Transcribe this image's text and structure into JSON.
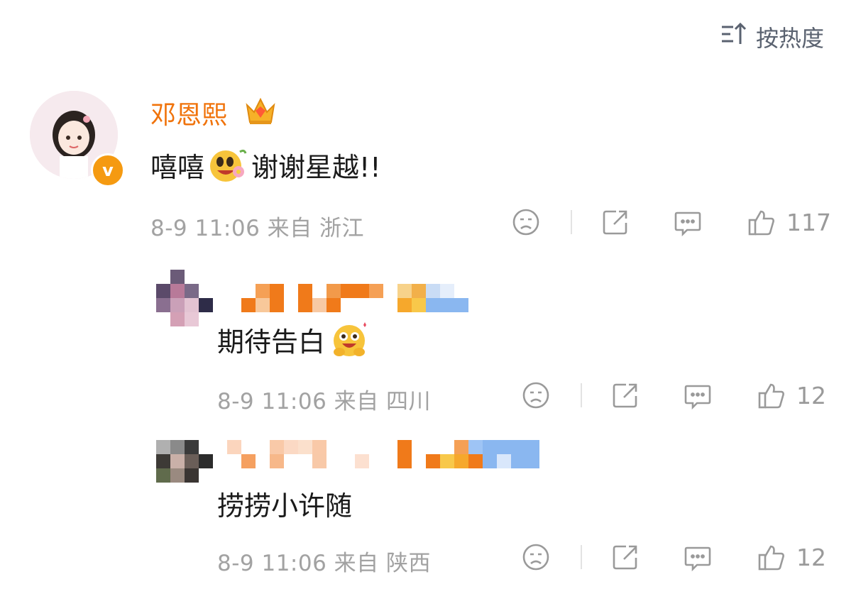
{
  "sort": {
    "label": "按热度",
    "icon": "sort-icon"
  },
  "comments": [
    {
      "username": "邓恩熙",
      "badge": "crown-icon",
      "verified": "v",
      "text_before": "嘻嘻",
      "emoji": "flower-emoji",
      "text_after": "谢谢星越!!",
      "meta": "8-9 11:06 来自 浙江",
      "likes": "117"
    },
    {
      "username": "",
      "text_before": "期待告白",
      "emoji": "hug-emoji",
      "meta": "8-9 11:06 来自 四川",
      "likes": "12"
    },
    {
      "username": "",
      "text_before": "捞捞小许随",
      "meta": "8-9 11:06 来自 陕西",
      "likes": "12"
    }
  ],
  "colors": {
    "accent": "#f0730b",
    "meta": "#a2a2a2",
    "icon": "#9a9a9a"
  }
}
